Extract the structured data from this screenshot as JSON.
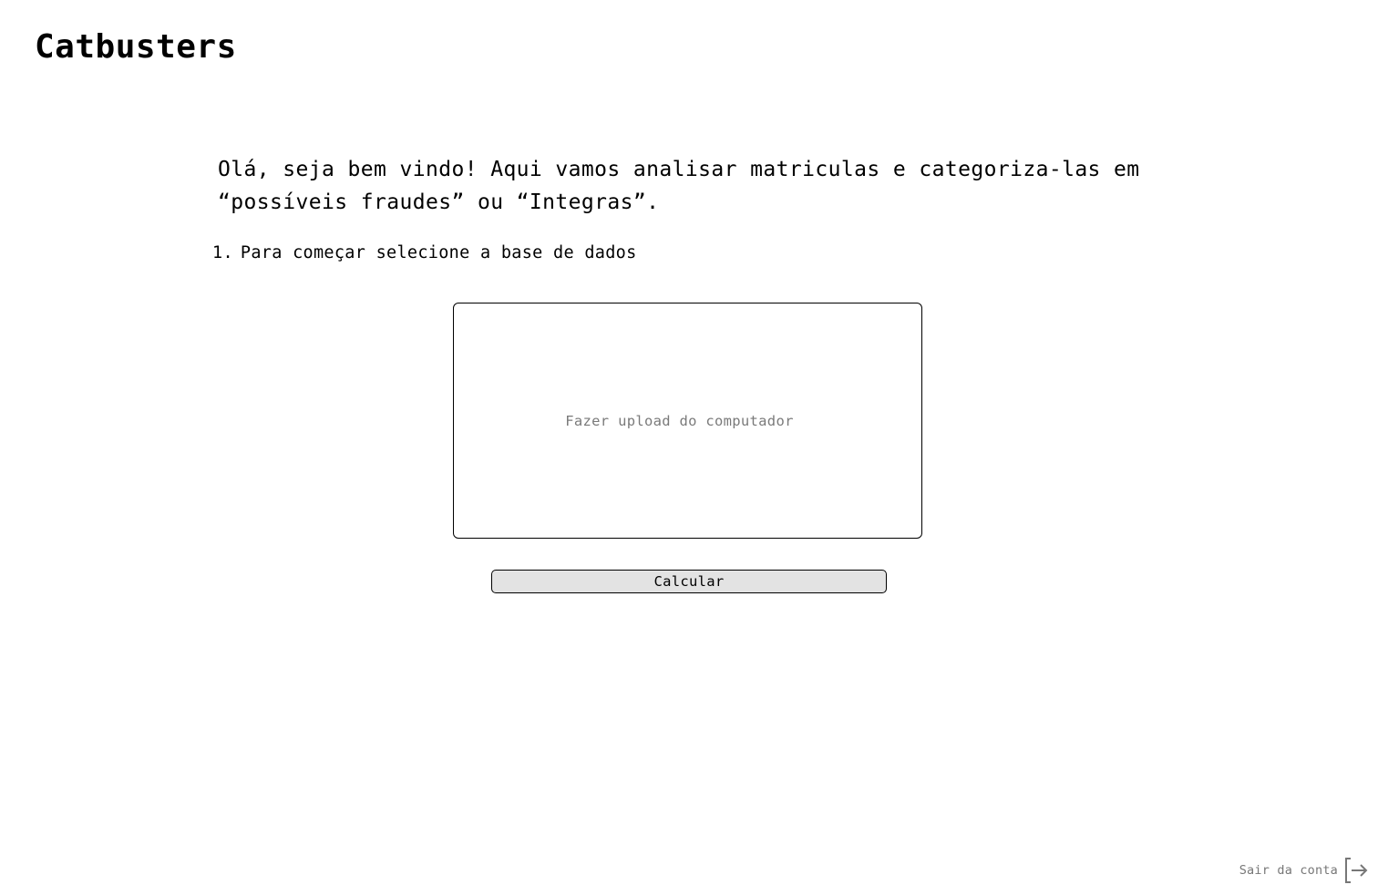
{
  "header": {
    "title": "Catbusters"
  },
  "main": {
    "intro": "Olá, seja bem vindo! Aqui vamos analisar matriculas e categoriza-las em “possíveis fraudes” ou “Integras”.",
    "steps": [
      {
        "number": "1.",
        "text": "Para começar selecione a base de dados"
      }
    ],
    "upload": {
      "label": "Fazer upload do computador"
    },
    "calculate_label": "Calcular"
  },
  "footer": {
    "logout_label": "Sair da conta",
    "logout_icon": "logout-icon"
  }
}
